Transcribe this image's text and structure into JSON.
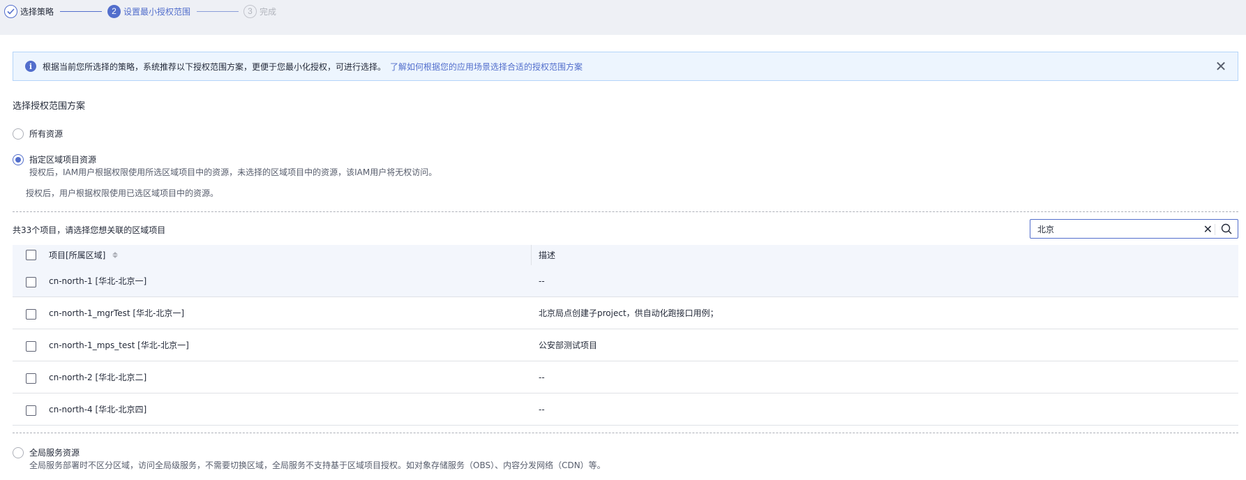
{
  "steps": [
    {
      "label": "选择策略",
      "status": "done"
    },
    {
      "number": "2",
      "label": "设置最小授权范围",
      "status": "active"
    },
    {
      "number": "3",
      "label": "完成",
      "status": "pending"
    }
  ],
  "alert": {
    "text": "根据当前您所选择的策略，系统推荐以下授权范围方案，更便于您最小化授权，可进行选择。",
    "link": "了解如何根据您的应用场景选择合适的授权范围方案"
  },
  "section_title": "选择授权范围方案",
  "options": {
    "all": {
      "label": "所有资源"
    },
    "region": {
      "label": "指定区域项目资源",
      "desc": "授权后，IAM用户根据权限使用所选区域项目中的资源，未选择的区域项目中的资源，该IAM用户将无权访问。",
      "note": "授权后，用户根据权限使用已选区域项目中的资源。"
    },
    "global": {
      "label": "全局服务资源",
      "desc": "全局服务部署时不区分区域，访问全局级服务，不需要切换区域，全局服务不支持基于区域项目授权。如对象存储服务（OBS）、内容分发网络（CDN）等。"
    }
  },
  "selected_option": "region",
  "count_text": "共33个项目，请选择您想关联的区域项目",
  "search": {
    "value": "北京"
  },
  "table": {
    "headers": [
      "项目[所属区域]",
      "描述"
    ],
    "rows": [
      {
        "project": "cn-north-1 [华北-北京一]",
        "desc": "--"
      },
      {
        "project": "cn-north-1_mgrTest [华北-北京一]",
        "desc": "北京局点创建子project，供自动化跑接口用例；"
      },
      {
        "project": "cn-north-1_mps_test [华北-北京一]",
        "desc": "公安部测试项目"
      },
      {
        "project": "cn-north-2 [华北-北京二]",
        "desc": "--"
      },
      {
        "project": "cn-north-4 [华北-北京四]",
        "desc": "--"
      }
    ]
  },
  "colors": {
    "accent": "#526ecc",
    "alert_bg": "#edf5fe",
    "header_bg": "#eef0f5"
  }
}
